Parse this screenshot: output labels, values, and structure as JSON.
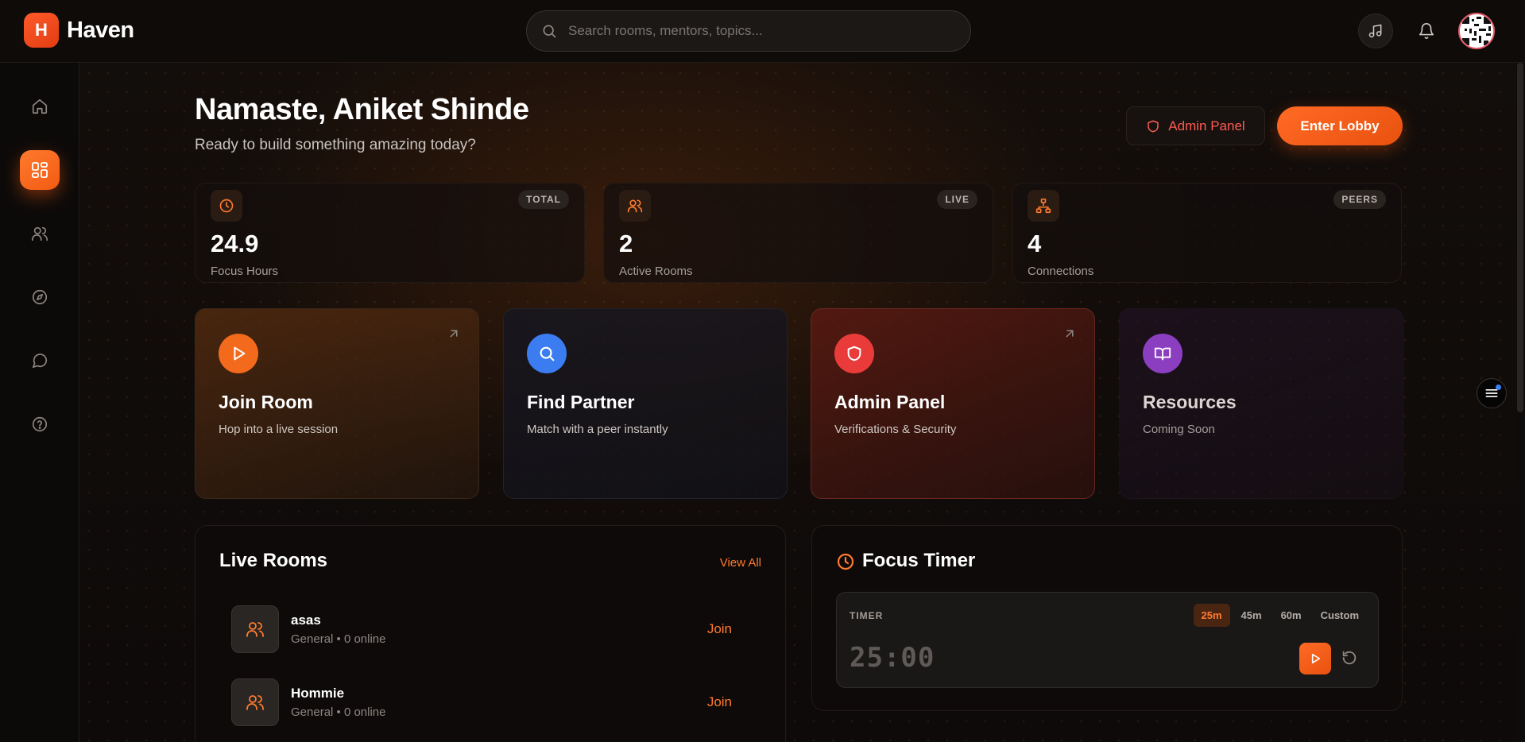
{
  "app": {
    "logo_letter": "H",
    "name": "Haven"
  },
  "search": {
    "placeholder": "Search rooms, mentors, topics..."
  },
  "topbar_icons": [
    "music-note-icon",
    "bell-icon",
    "avatar"
  ],
  "sidebar": {
    "items": [
      {
        "icon": "home-icon",
        "active": false
      },
      {
        "icon": "dashboard-icon",
        "active": true
      },
      {
        "icon": "users-icon",
        "active": false
      },
      {
        "icon": "compass-icon",
        "active": false
      },
      {
        "icon": "chat-icon",
        "active": false
      },
      {
        "icon": "help-icon",
        "active": false
      }
    ]
  },
  "header": {
    "greeting": "Namaste, Aniket Shinde",
    "subtitle": "Ready to build something amazing today?",
    "admin_button": "Admin Panel",
    "lobby_button": "Enter Lobby"
  },
  "stats": [
    {
      "badge": "TOTAL",
      "value": "24.9",
      "label": "Focus Hours",
      "icon": "clock-icon"
    },
    {
      "badge": "LIVE",
      "value": "2",
      "label": "Active Rooms",
      "icon": "users-icon"
    },
    {
      "badge": "PEERS",
      "value": "4",
      "label": "Connections",
      "icon": "network-icon"
    }
  ],
  "actions": [
    {
      "title": "Join Room",
      "subtitle": "Hop into a live session",
      "icon": "play-icon",
      "color": "#f36a1d"
    },
    {
      "title": "Find Partner",
      "subtitle": "Match with a peer instantly",
      "icon": "search-icon",
      "color": "#3b7cf0"
    },
    {
      "title": "Admin Panel",
      "subtitle": "Verifications & Security",
      "icon": "shield-icon",
      "color": "#ea3b3b"
    },
    {
      "title": "Resources",
      "subtitle": "Coming Soon",
      "icon": "book-icon",
      "color": "#8b3fc0"
    }
  ],
  "live_rooms": {
    "title": "Live Rooms",
    "view_all": "View All",
    "rooms": [
      {
        "name": "asas",
        "meta": "General • 0 online",
        "join": "Join"
      },
      {
        "name": "Hommie",
        "meta": "General • 0 online",
        "join": "Join"
      }
    ]
  },
  "focus_timer": {
    "title": "Focus Timer",
    "label": "TIMER",
    "presets": [
      "25m",
      "45m",
      "60m",
      "Custom"
    ],
    "active_preset": "25m",
    "value": "25:00"
  },
  "colors": {
    "accent": "#f25b12",
    "bg": "#0b0908"
  }
}
